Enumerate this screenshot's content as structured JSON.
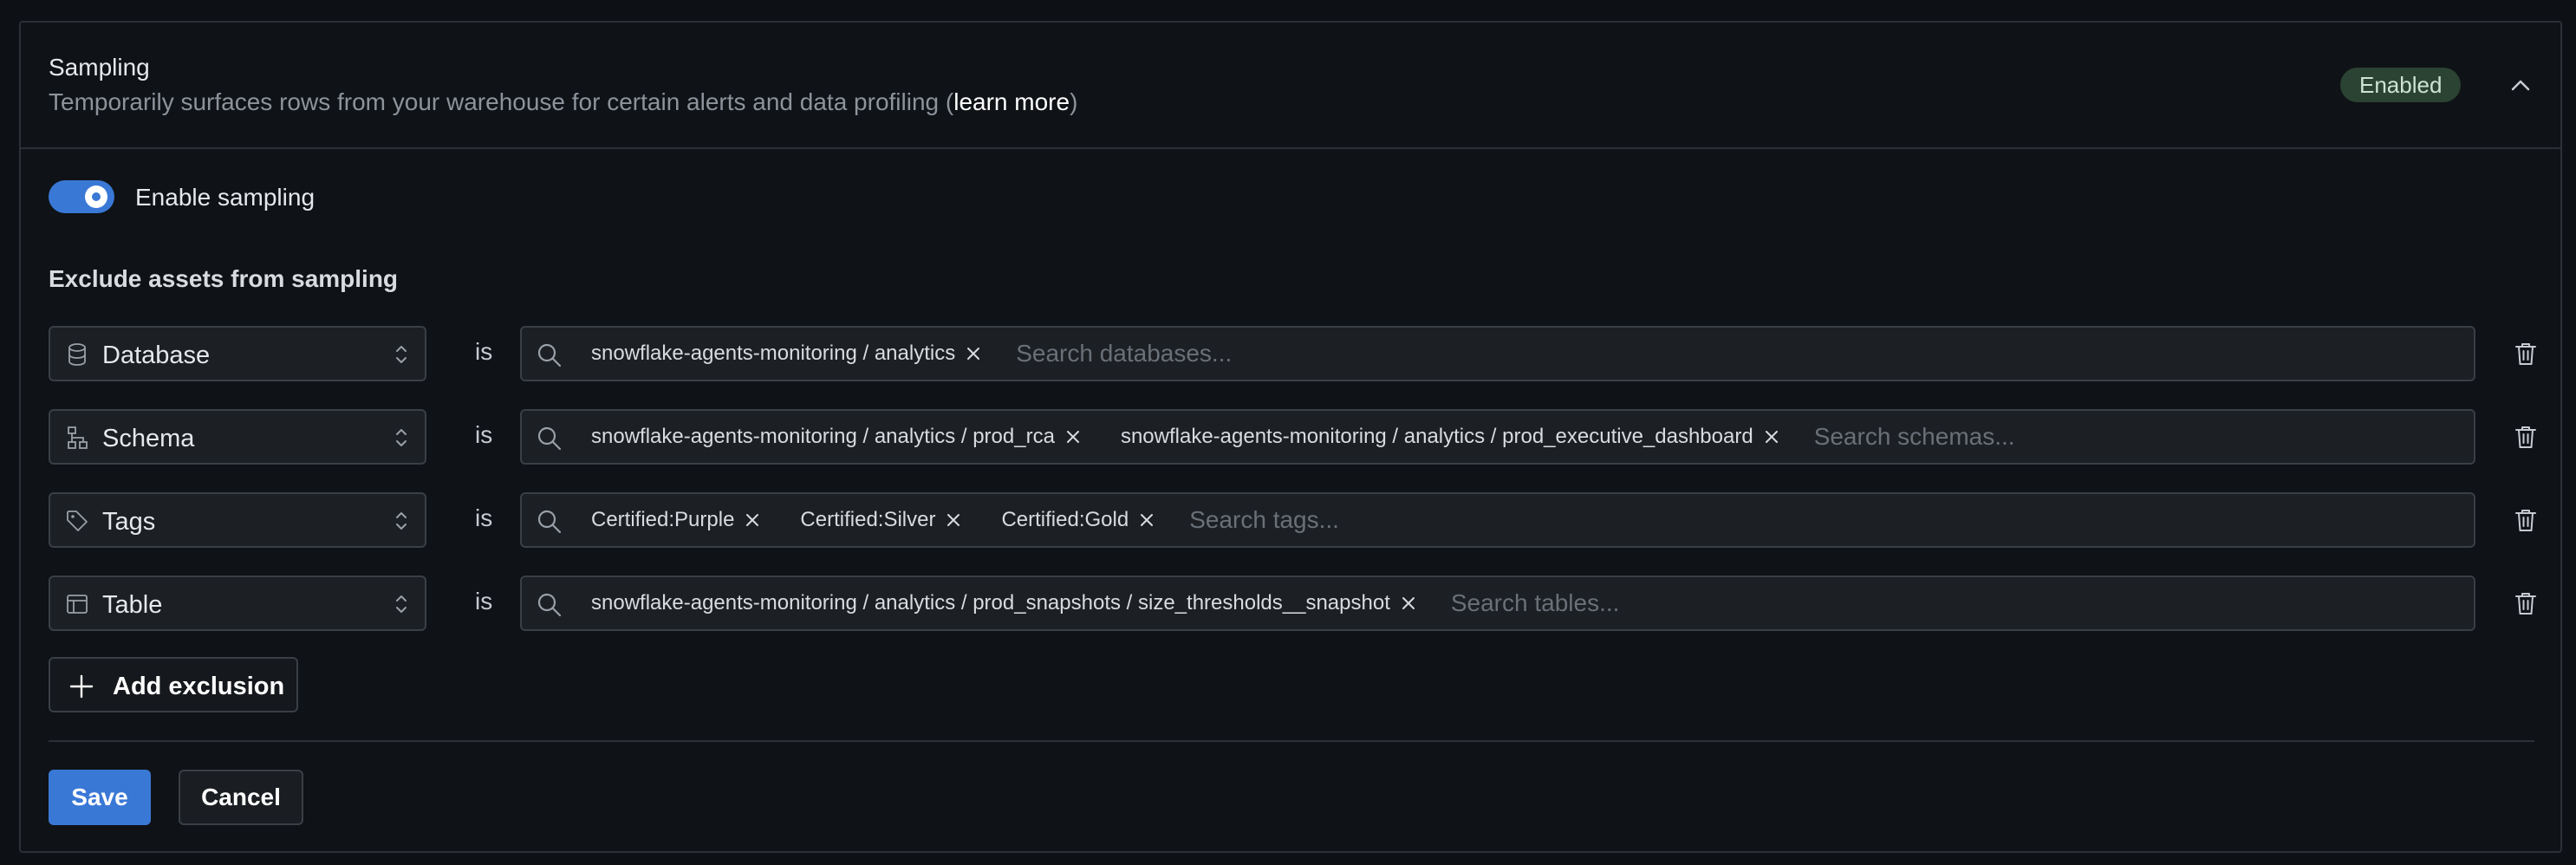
{
  "header": {
    "title": "Sampling",
    "subtitle_prefix": "Temporarily surfaces rows from your warehouse for certain alerts and data profiling (",
    "subtitle_link": "learn more",
    "subtitle_suffix": ")",
    "status_badge": "Enabled",
    "collapse_icon": "chevron-up-icon"
  },
  "sampling_toggle": {
    "label": "Enable sampling",
    "checked": true
  },
  "exclusions": {
    "title": "Exclude assets from sampling",
    "operator": "is",
    "rows": [
      {
        "type": "Database",
        "icon": "database-icon",
        "chips": [
          "snowflake-agents-monitoring / analytics"
        ],
        "placeholder": "Search databases..."
      },
      {
        "type": "Schema",
        "icon": "schema-icon",
        "chips": [
          "snowflake-agents-monitoring / analytics / prod_rca",
          "snowflake-agents-monitoring / analytics / prod_executive_dashboard"
        ],
        "placeholder": "Search schemas..."
      },
      {
        "type": "Tags",
        "icon": "tag-icon",
        "chips": [
          "Certified:Purple",
          "Certified:Silver",
          "Certified:Gold"
        ],
        "placeholder": "Search tags..."
      },
      {
        "type": "Table",
        "icon": "table-icon",
        "chips": [
          "snowflake-agents-monitoring / analytics / prod_snapshots / size_thresholds__snapshot"
        ],
        "placeholder": "Search tables..."
      }
    ],
    "add_button": "Add exclusion"
  },
  "actions": {
    "save": "Save",
    "cancel": "Cancel"
  },
  "colors": {
    "accent": "#3a78d6",
    "badge_bg": "#2b4332",
    "panel_bg": "#0f1216"
  }
}
